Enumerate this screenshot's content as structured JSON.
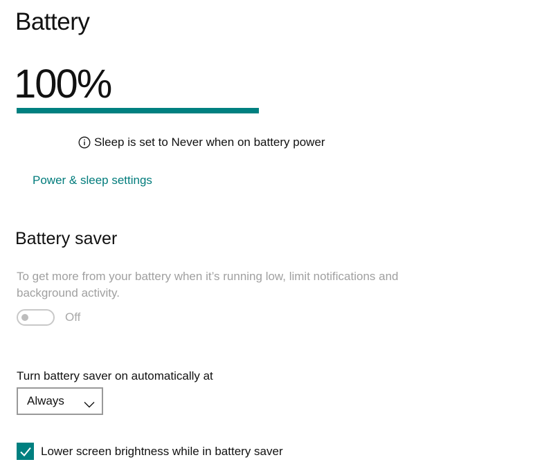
{
  "battery": {
    "title": "Battery",
    "percent_text": "100%",
    "percent_value": 100,
    "accent_color": "#008080",
    "info_icon": "info-icon",
    "sleep_info": "Sleep is set to Never when on battery power",
    "power_sleep_link": "Power & sleep settings"
  },
  "battery_saver": {
    "heading": "Battery saver",
    "description": "To get more from your battery when it’s running low, limit notifications and background activity.",
    "toggle_state": "Off",
    "auto_label": "Turn battery saver on automatically at",
    "auto_value": "Always",
    "dropdown_icon": "chevron-down-icon",
    "lower_brightness_label": "Lower screen brightness while in battery saver",
    "lower_brightness_checked": true,
    "check_icon": "checkmark-icon"
  }
}
